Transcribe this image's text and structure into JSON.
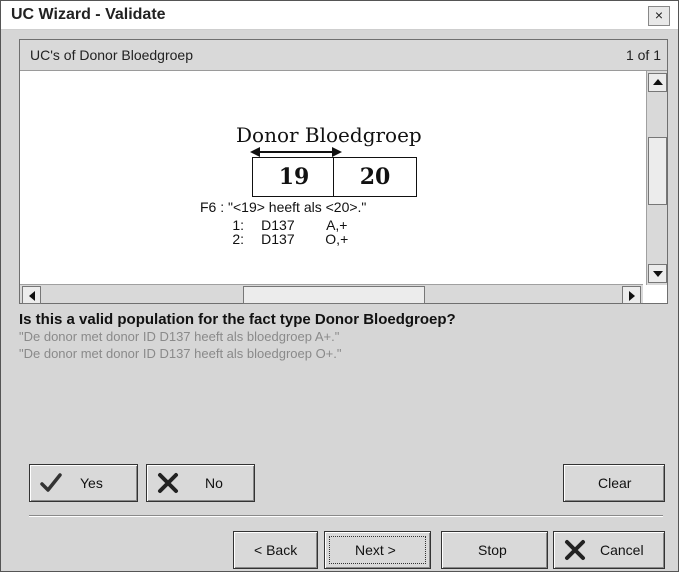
{
  "window": {
    "title": "UC Wizard - Validate",
    "close_label": "×"
  },
  "panel": {
    "header": "UC's of Donor Bloedgroep",
    "counter": "1 of 1"
  },
  "fact": {
    "title": "Donor Bloedgroep",
    "role1": "19",
    "role2": "20",
    "reading": "F6 : \"<19> heeft als <20>.\"",
    "rows": [
      {
        "n": "1:",
        "id": "D137",
        "val": "A,+"
      },
      {
        "n": "2:",
        "id": "D137",
        "val": "O,+"
      }
    ]
  },
  "question": "Is this a valid population for the fact type Donor Bloedgroep?",
  "sentences": [
    "\"De donor met donor ID D137 heeft als bloedgroep A+.\"",
    "\"De donor met donor ID D137 heeft als bloedgroep O+.\""
  ],
  "buttons": {
    "yes": "Yes",
    "no": "No",
    "clear": "Clear",
    "back": "< Back",
    "next": "Next >",
    "stop": "Stop",
    "cancel": "Cancel"
  },
  "icons": {
    "yes": "checkmark-icon",
    "no": "x-icon",
    "cancel": "x-icon"
  }
}
